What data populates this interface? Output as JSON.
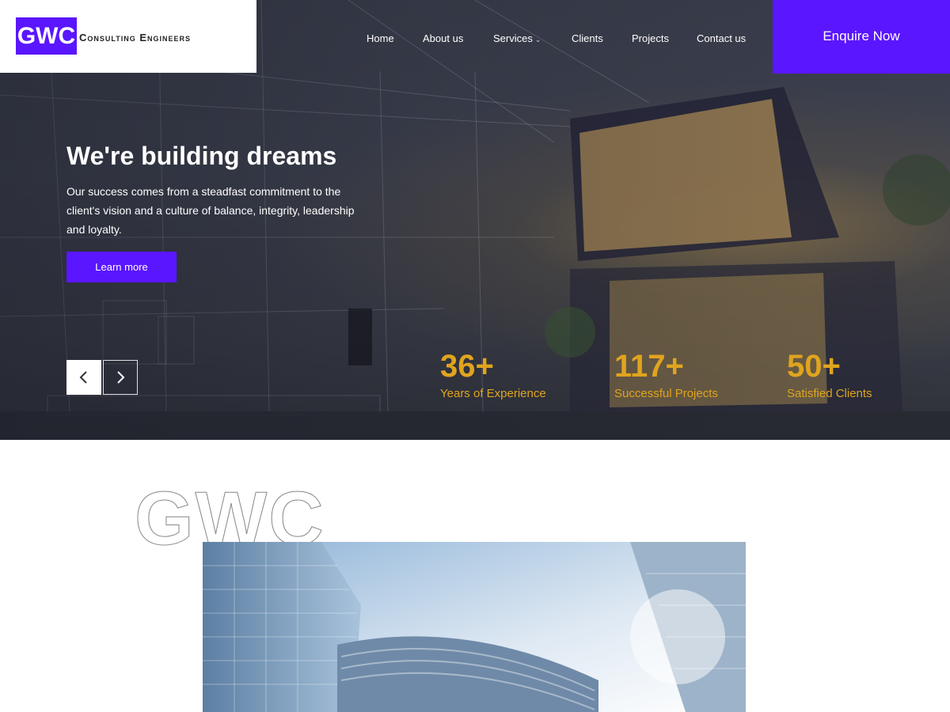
{
  "logo": {
    "mark": "GWC",
    "text": "Consulting Engineers"
  },
  "nav": {
    "items": [
      {
        "label": "Home"
      },
      {
        "label": "About us"
      },
      {
        "label": "Services"
      },
      {
        "label": "Clients"
      },
      {
        "label": "Projects"
      },
      {
        "label": "Contact us"
      }
    ],
    "services_icon": "chevron-down-icon",
    "cta_label": "Enquire Now"
  },
  "hero": {
    "title": "We're building dreams",
    "description": "Our success comes from a steadfast commitment to the client's vision and a culture of balance, integrity, leadership and loyalty.",
    "button_label": "Learn more",
    "prev_icon": "chevron-left-icon",
    "next_icon": "chevron-right-icon"
  },
  "stats": [
    {
      "value": "36+",
      "label": "Years of Experience"
    },
    {
      "value": "117+",
      "label": "Successful Projects"
    },
    {
      "value": "50+",
      "label": "Satisfied Clients"
    }
  ],
  "about": {
    "outline_text": "GWC"
  },
  "colors": {
    "accent": "#5a16ff",
    "stat": "#e0a41e"
  }
}
